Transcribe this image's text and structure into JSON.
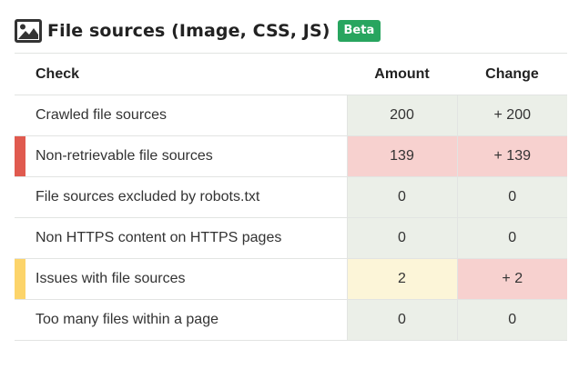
{
  "header": {
    "icon": "image-icon",
    "title": "File sources (Image, CSS, JS)",
    "badge": "Beta"
  },
  "table": {
    "columns": [
      "Check",
      "Amount",
      "Change"
    ],
    "rows": [
      {
        "check": "Crawled file sources",
        "amount": "200",
        "change": "+ 200",
        "flag": "none",
        "amount_status": "ok",
        "change_status": "ok"
      },
      {
        "check": "Non-retrievable file sources",
        "amount": "139",
        "change": "+ 139",
        "flag": "error",
        "amount_status": "error",
        "change_status": "error"
      },
      {
        "check": "File sources excluded by robots.txt",
        "amount": "0",
        "change": "0",
        "flag": "none",
        "amount_status": "ok",
        "change_status": "ok"
      },
      {
        "check": "Non HTTPS content on HTTPS pages",
        "amount": "0",
        "change": "0",
        "flag": "none",
        "amount_status": "ok",
        "change_status": "ok"
      },
      {
        "check": "Issues with file sources",
        "amount": "2",
        "change": "+ 2",
        "flag": "warning",
        "amount_status": "warning",
        "change_status": "error"
      },
      {
        "check": "Too many files within a page",
        "amount": "0",
        "change": "0",
        "flag": "none",
        "amount_status": "ok",
        "change_status": "ok"
      }
    ]
  },
  "colors": {
    "ok_bg": "#ebefe8",
    "error_bg": "#f7d1cf",
    "warning_bg": "#fcf5d8",
    "error_flag": "#e05a4f",
    "warning_flag": "#fcd46a",
    "badge": "#28a55f"
  }
}
